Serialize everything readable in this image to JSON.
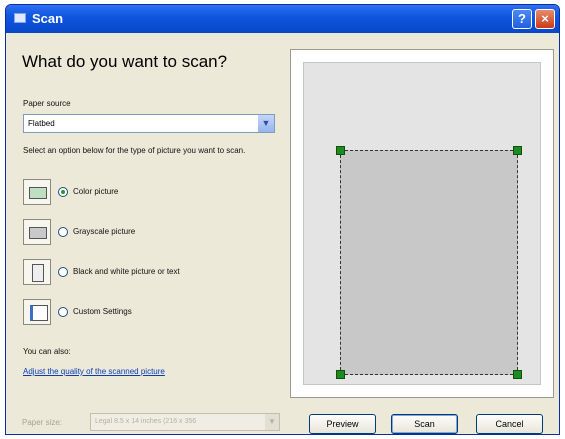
{
  "window": {
    "title": "Scan",
    "help": "?",
    "close": "×"
  },
  "heading": "What do you want to scan?",
  "paper_source": {
    "label": "Paper source",
    "value": "Flatbed"
  },
  "instructions": "Select an option below for the type of picture you want to scan.",
  "options": [
    {
      "label": "Color picture",
      "selected": true,
      "icon": "color-picture-icon"
    },
    {
      "label": "Grayscale picture",
      "selected": false,
      "icon": "grayscale-picture-icon"
    },
    {
      "label": "Black and white picture or text",
      "selected": false,
      "icon": "black-white-picture-icon"
    },
    {
      "label": "Custom Settings",
      "selected": false,
      "icon": "custom-settings-icon"
    }
  ],
  "you_can_also": "You can also:",
  "adjust_link": "Adjust the quality of the scanned picture",
  "paper_size": {
    "label": "Paper size:",
    "value": "Legal 8.5 x 14 inches (216 x 356"
  },
  "buttons": {
    "preview": "Preview",
    "scan": "Scan",
    "cancel": "Cancel"
  },
  "colors": {
    "titlebar": "#0a4fd4",
    "dialog_bg": "#ece9d8",
    "link": "#0b3bb8",
    "selection_handle": "#1f8a1f"
  }
}
